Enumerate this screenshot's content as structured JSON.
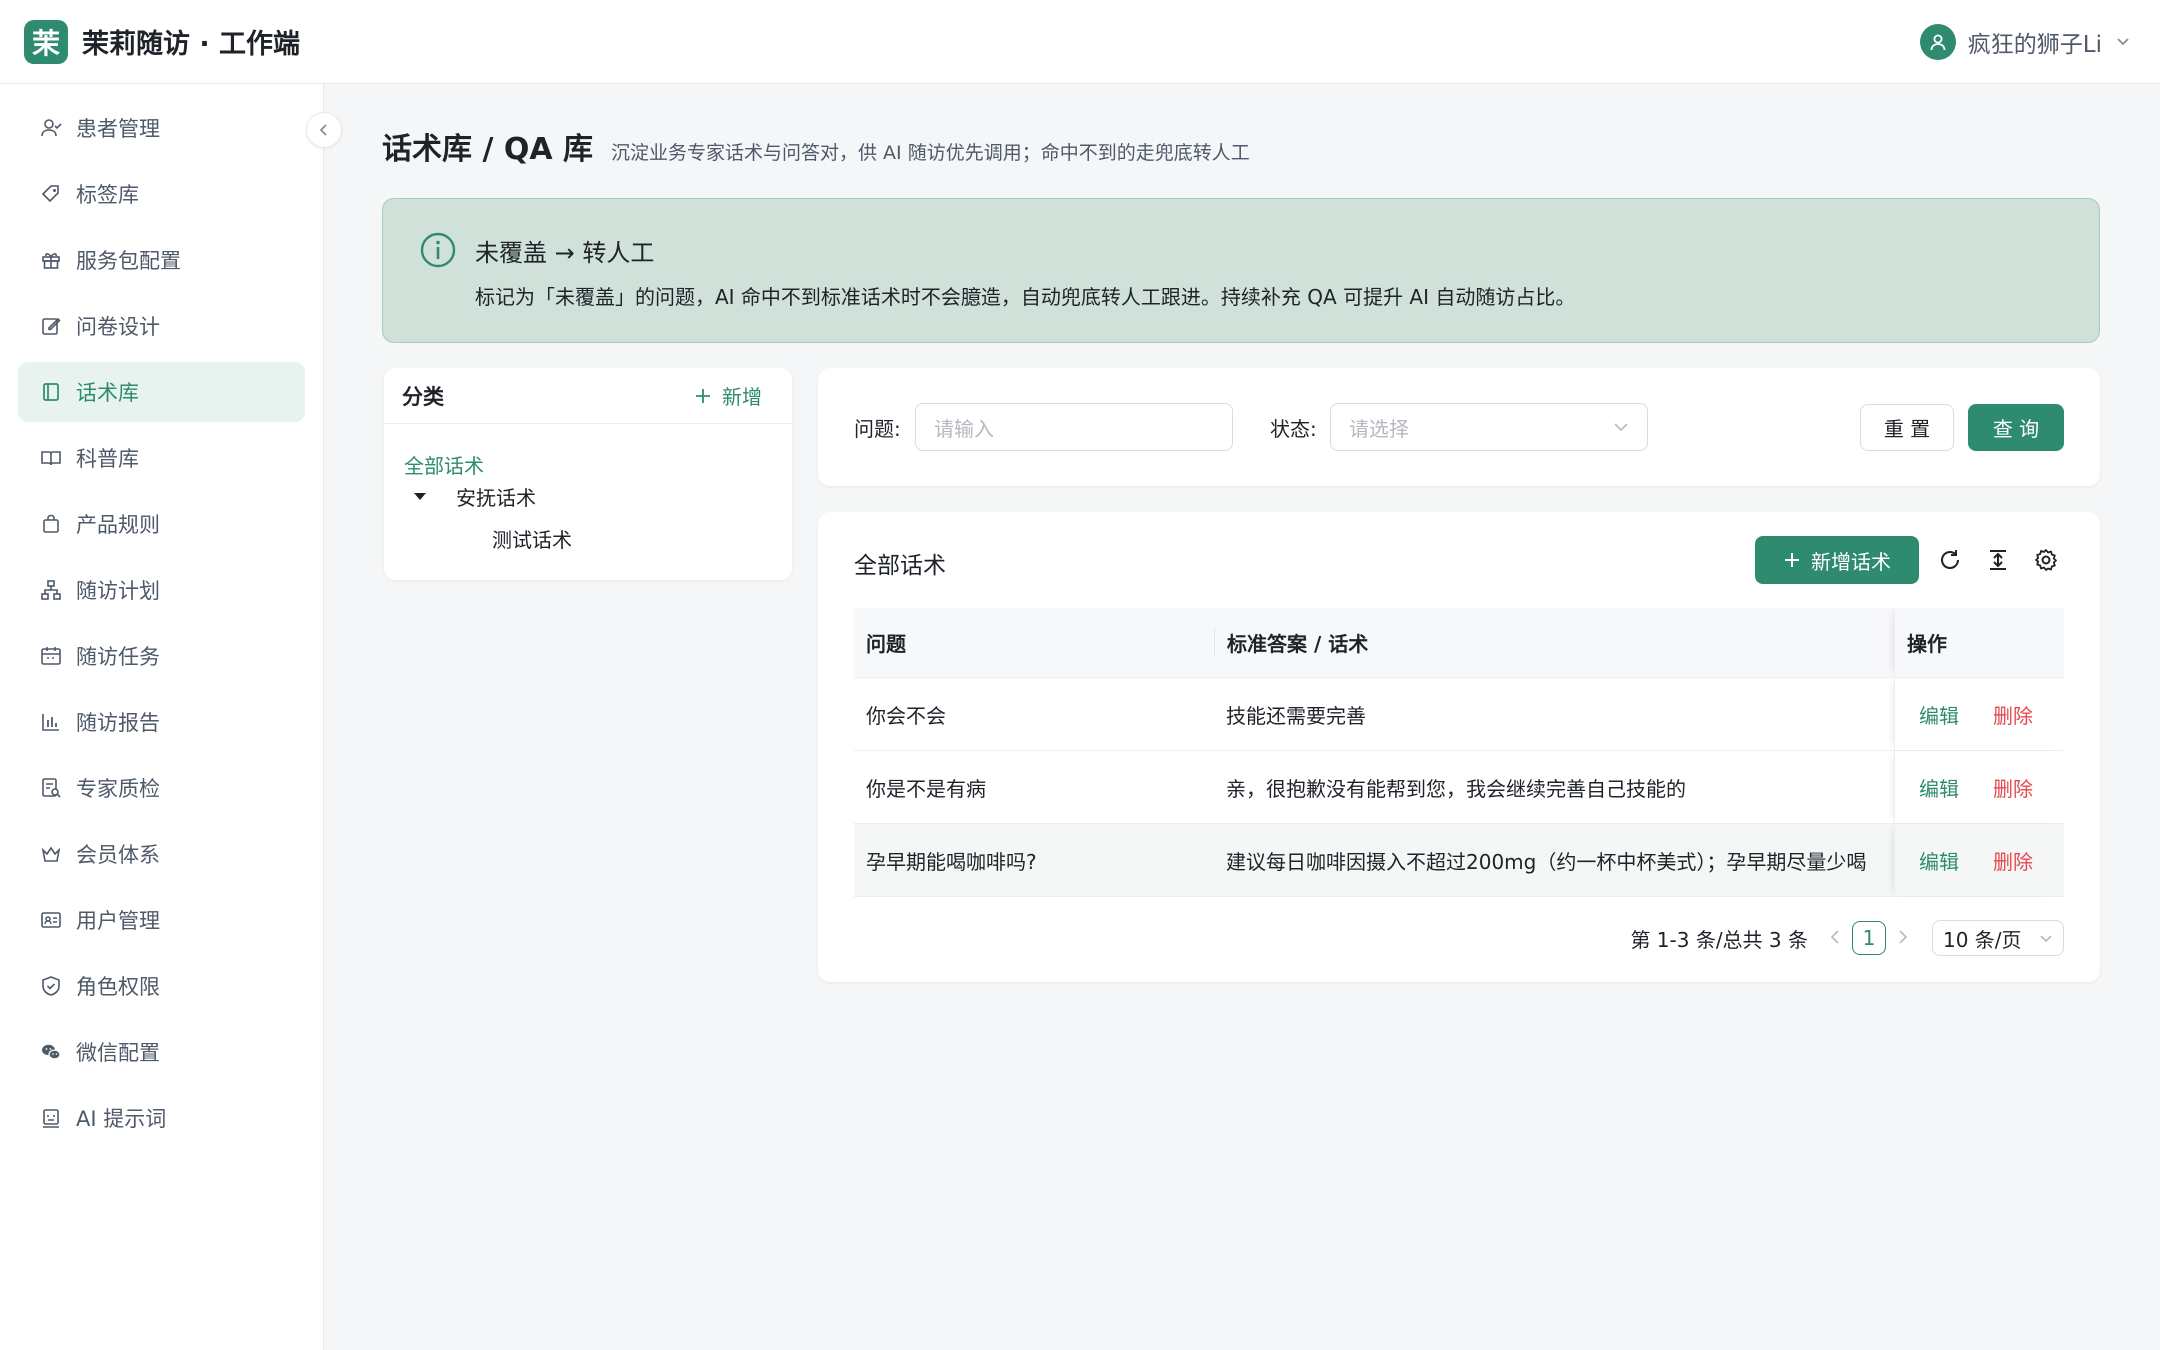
{
  "header": {
    "logo_char": "茉",
    "app_title": "茉莉随访 · 工作端",
    "user_name": "疯狂的狮子Li"
  },
  "sidebar": {
    "items": [
      {
        "label": "患者管理",
        "icon": "patients-icon"
      },
      {
        "label": "标签库",
        "icon": "tag-icon"
      },
      {
        "label": "服务包配置",
        "icon": "gift-icon"
      },
      {
        "label": "问卷设计",
        "icon": "edit-icon"
      },
      {
        "label": "话术库",
        "icon": "book-icon",
        "active": true
      },
      {
        "label": "科普库",
        "icon": "open-book-icon"
      },
      {
        "label": "产品规则",
        "icon": "bag-icon"
      },
      {
        "label": "随访计划",
        "icon": "hierarchy-icon"
      },
      {
        "label": "随访任务",
        "icon": "calendar-icon"
      },
      {
        "label": "随访报告",
        "icon": "bar-chart-icon"
      },
      {
        "label": "专家质检",
        "icon": "audit-icon"
      },
      {
        "label": "会员体系",
        "icon": "crown-icon"
      },
      {
        "label": "用户管理",
        "icon": "id-card-icon"
      },
      {
        "label": "角色权限",
        "icon": "shield-icon"
      },
      {
        "label": "微信配置",
        "icon": "wechat-icon"
      },
      {
        "label": "AI 提示词",
        "icon": "robot-icon"
      }
    ]
  },
  "page": {
    "title": "话术库 / QA 库",
    "subtitle": "沉淀业务专家话术与问答对，供 AI 随访优先调用；命中不到的走兜底转人工"
  },
  "alert": {
    "title": "未覆盖 → 转人工",
    "text": "标记为「未覆盖」的问题，AI 命中不到标准话术时不会臆造，自动兜底转人工跟进。持续补充 QA 可提升 AI 自动随访占比。"
  },
  "category": {
    "title": "分类",
    "add_label": "新增",
    "tree": {
      "all": "全部话术",
      "node": "安抚话术",
      "child": "测试话术"
    }
  },
  "filter": {
    "question_label": "问题:",
    "question_placeholder": "请输入",
    "status_label": "状态:",
    "status_placeholder": "请选择",
    "reset_label": "重 置",
    "query_label": "查 询"
  },
  "table": {
    "title": "全部话术",
    "add_label": "新增话术",
    "columns": [
      "问题",
      "标准答案 / 话术",
      "操作"
    ],
    "rows": [
      {
        "question": "你会不会",
        "answer": "技能还需要完善"
      },
      {
        "question": "你是不是有病",
        "answer": "亲，很抱歉没有能帮到您，我会继续完善自己技能的"
      },
      {
        "question": "孕早期能喝咖啡吗?",
        "answer": "建议每日咖啡因摄入不超过200mg（约一杯中杯美式）；孕早期尽量少喝"
      }
    ],
    "edit_label": "编辑",
    "delete_label": "删除"
  },
  "pager": {
    "summary": "第 1-3 条/总共 3 条",
    "current": "1",
    "page_size": "10 条/页"
  },
  "colors": {
    "brand": "#2e8b6f",
    "danger": "#e5484d",
    "alert_bg": "#cfe1d9"
  }
}
